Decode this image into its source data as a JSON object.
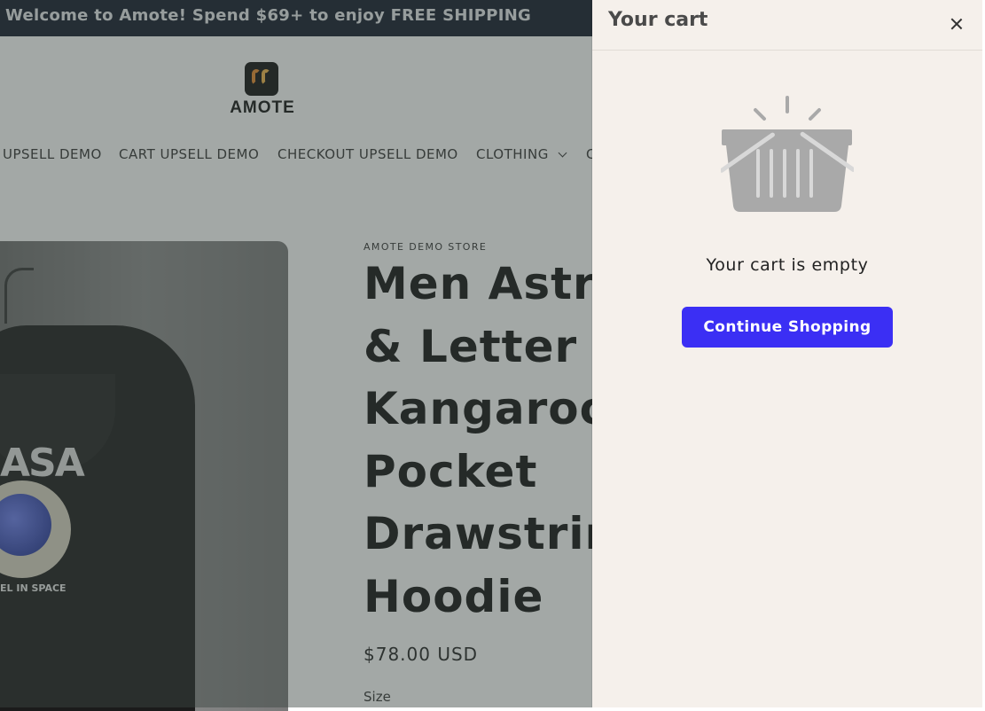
{
  "announcement": {
    "text": "Welcome to Amote! Spend $69+ to enjoy FREE SHIPPING"
  },
  "header": {
    "logo_text": "AMOTE",
    "nav": [
      {
        "label": "UPSELL DEMO"
      },
      {
        "label": "CART UPSELL DEMO"
      },
      {
        "label": "CHECKOUT UPSELL DEMO"
      },
      {
        "label": "CLOTHING"
      },
      {
        "label": "C"
      }
    ]
  },
  "product": {
    "vendor": "AMOTE DEMO STORE",
    "title_lines": [
      "Men Astr",
      "& Letter G",
      "Kangaroo",
      "Pocket",
      "Drawstrin",
      "Hoodie"
    ],
    "price": "$78.00 USD",
    "size_label": "Size",
    "image_print_text": "ASA",
    "image_print_sub": "EL IN SPACE"
  },
  "cart": {
    "title": "Your cart",
    "empty_message": "Your cart is empty",
    "continue_label": "Continue Shopping",
    "accent_color": "#3b2ff4",
    "close_icon": "close-icon",
    "empty_icon": "basket-icon"
  }
}
